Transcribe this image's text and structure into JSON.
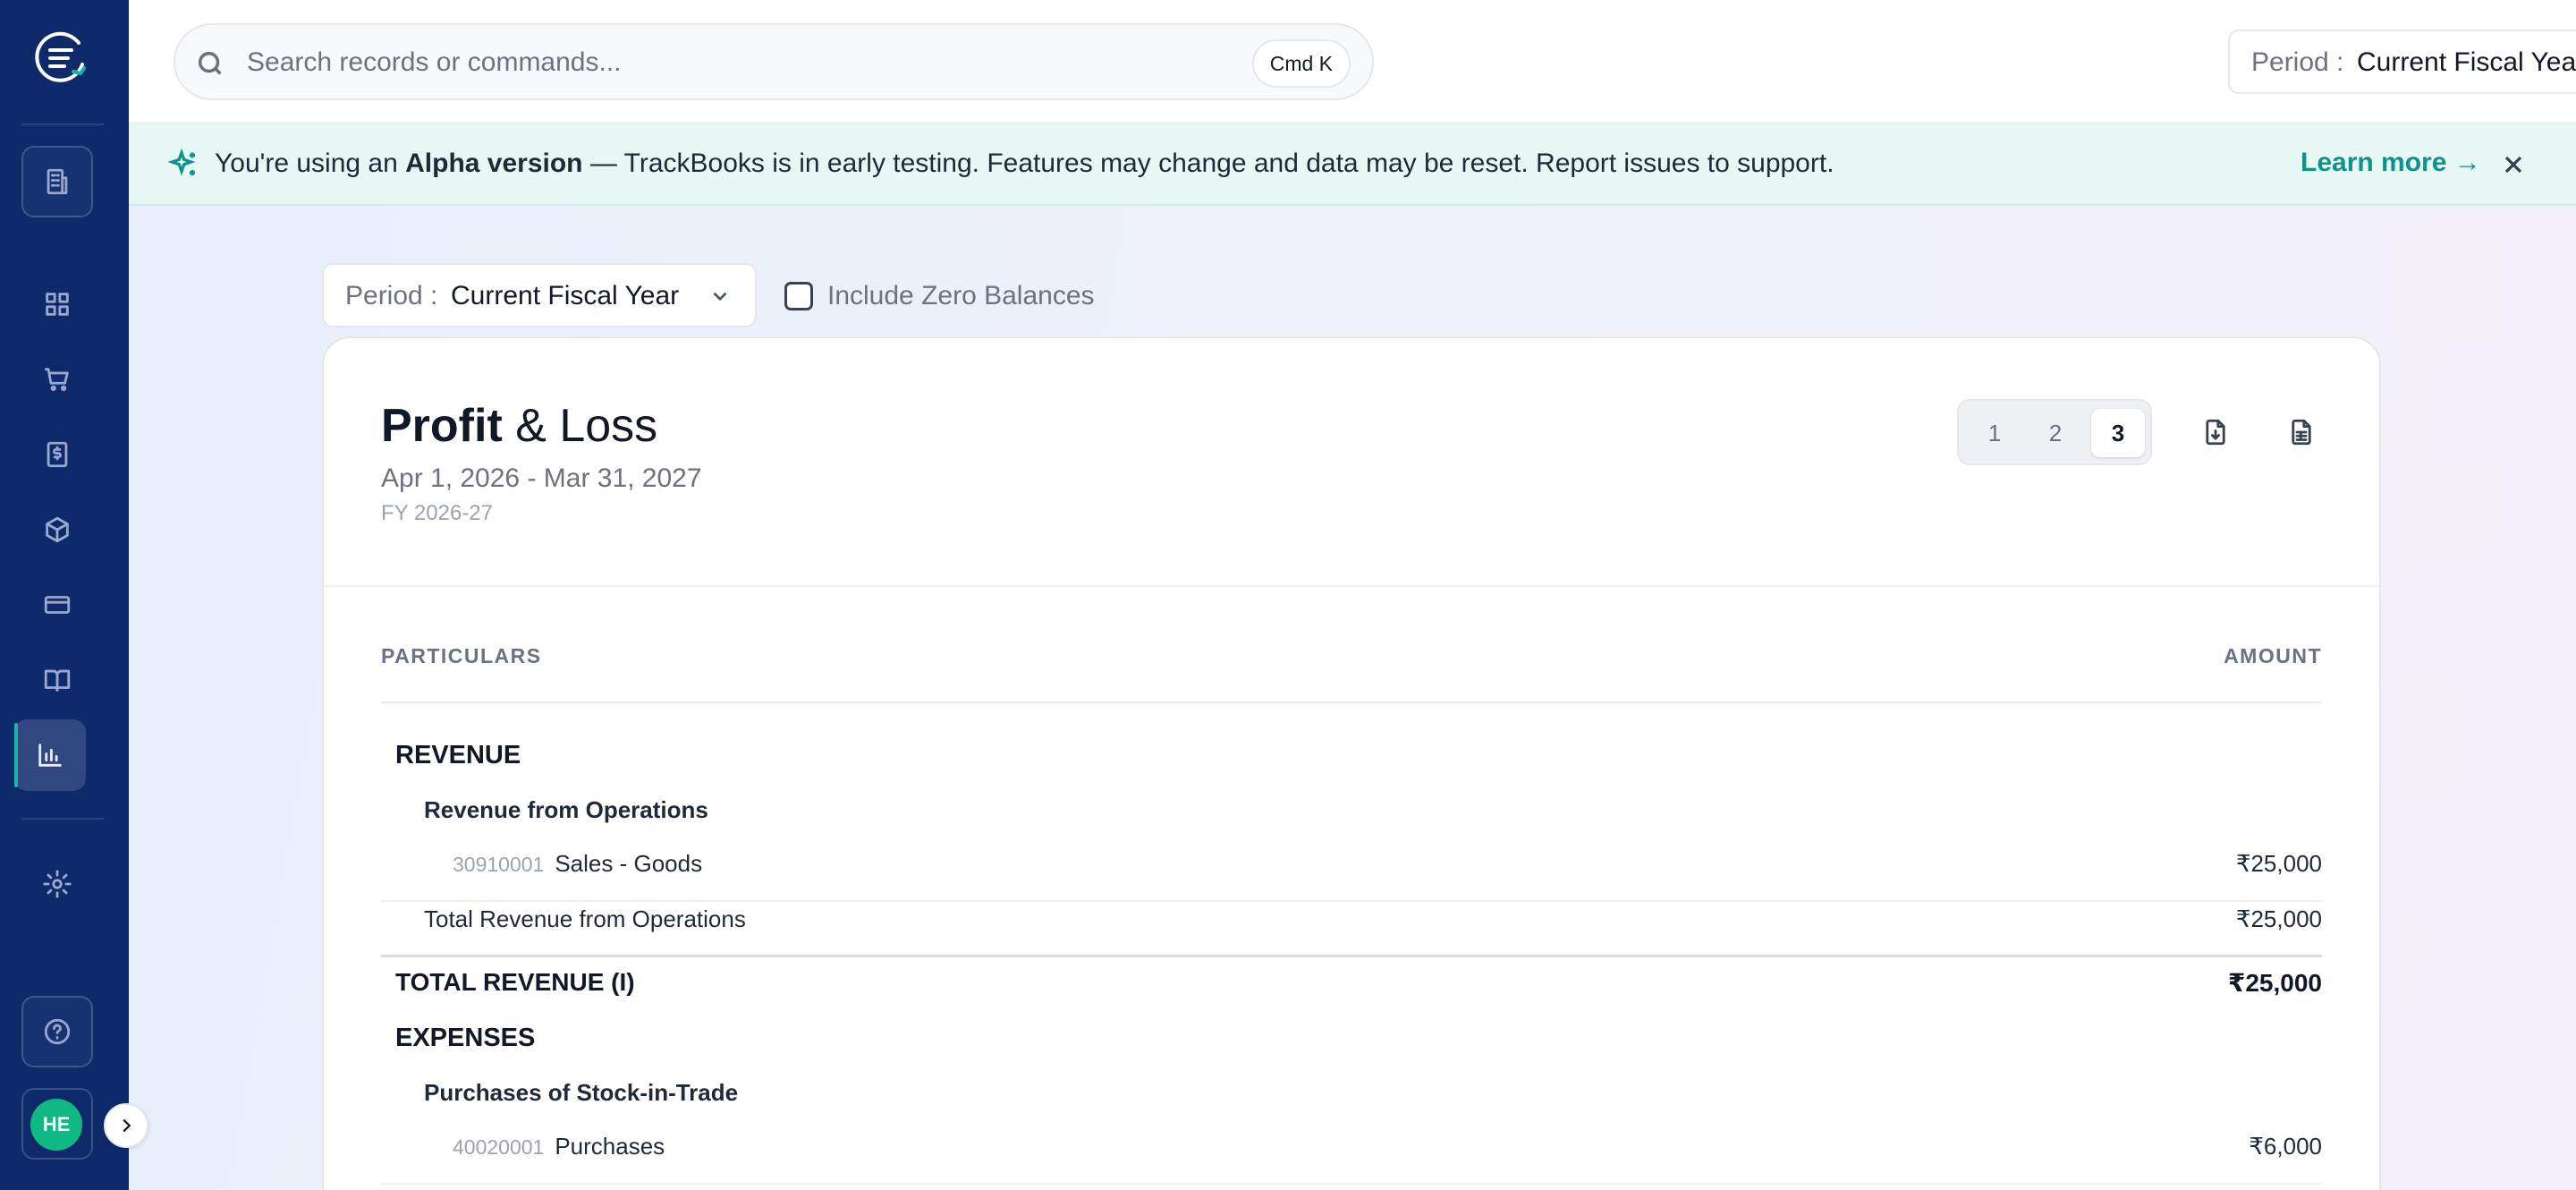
{
  "sidebar": {
    "items": [
      {
        "name": "dashboard",
        "icon": "grid-icon"
      },
      {
        "name": "sales",
        "icon": "cart-icon"
      },
      {
        "name": "invoices",
        "icon": "dollar-document-icon"
      },
      {
        "name": "inventory",
        "icon": "box-icon"
      },
      {
        "name": "payments",
        "icon": "credit-card-icon"
      },
      {
        "name": "ledger",
        "icon": "book-open-icon"
      },
      {
        "name": "reports",
        "icon": "bar-chart-icon",
        "active": true
      },
      {
        "name": "settings",
        "icon": "gear-icon"
      }
    ],
    "user_initials": "HE"
  },
  "topbar": {
    "search_placeholder": "Search records or commands...",
    "shortcut": "Cmd K",
    "period_label": "Period :",
    "period_value": "Current Fiscal Year"
  },
  "banner": {
    "prefix": "You're using an ",
    "strong": "Alpha version",
    "suffix": " — TrackBooks is in early testing. Features may change and data may be reset. Report issues to support.",
    "link": "Learn more →"
  },
  "filters": {
    "period_label": "Period :",
    "period_value": "Current Fiscal Year",
    "zero_balances_label": "Include Zero Balances"
  },
  "report": {
    "title_strong": "Profit",
    "title_rest": " & Loss",
    "date_range": "Apr 1, 2026 - Mar 31, 2027",
    "fiscal_year": "FY 2026-27",
    "levels": [
      "1",
      "2",
      "3"
    ],
    "selected_level": "3",
    "col_particulars": "PARTICULARS",
    "col_amount": "AMOUNT",
    "revenue_header": "REVENUE",
    "revenue_group": "Revenue from Operations",
    "revenue_account_code": "30910001",
    "revenue_account_name": "Sales - Goods",
    "revenue_account_amount": "₹25,000",
    "revenue_group_total_label": "Total Revenue from Operations",
    "revenue_group_total_amount": "₹25,000",
    "revenue_total_label": "TOTAL REVENUE (I)",
    "revenue_total_amount": "₹25,000",
    "expenses_header": "EXPENSES",
    "expense_group": "Purchases of Stock-in-Trade",
    "expense_account_code": "40020001",
    "expense_account_name": "Purchases",
    "expense_account_amount": "₹6,000"
  },
  "colors": {
    "sidebar_bg": "#0e2a6b",
    "accent": "#0d9488",
    "banner_bg": "#e6f7f4",
    "avatar_bg": "#10b981"
  }
}
